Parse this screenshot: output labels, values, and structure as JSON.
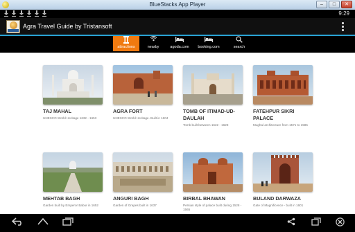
{
  "window": {
    "title": "BlueStacks App Player"
  },
  "status_bar": {
    "time": "9:29",
    "notification_icons": [
      "download-icon",
      "download-icon",
      "download-icon",
      "download-icon",
      "download-icon",
      "download-icon"
    ]
  },
  "action_bar": {
    "app_title": "Agra Travel Guide by Tristansoft",
    "app_icon": "agra-app-icon"
  },
  "tabs": [
    {
      "label": "attractions",
      "icon": "pillar-icon",
      "active": true
    },
    {
      "label": "nearby",
      "icon": "signal-icon",
      "active": false
    },
    {
      "label": "agoda.com",
      "icon": "bed-icon",
      "active": false
    },
    {
      "label": "booking.com",
      "icon": "bed-icon",
      "active": false
    },
    {
      "label": "search",
      "icon": "search-icon",
      "active": false
    }
  ],
  "attractions": [
    {
      "name": "TAJ MAHAL",
      "description": "UNESCO World Heritage 1632 - 1653"
    },
    {
      "name": "AGRA FORT",
      "description": "UNESCO World Heritage. Built in 1604"
    },
    {
      "name": "TOMB OF ITIMAD-UD-DAULAH",
      "description": "Tomb built between 1622 - 1628"
    },
    {
      "name": "FATEHPUR SIKRI PALACE",
      "description": "Mughal architecture from 1571 to 1585"
    },
    {
      "name": "MEHTAB BAGH",
      "description": "Garden built by Emperor Babur in 1652"
    },
    {
      "name": "ANGURI BAGH",
      "description": "Garden of Grapes built in 1637"
    },
    {
      "name": "BIRBAL BHAWAN",
      "description": "Persian style of palace built during 1528 - 1565"
    },
    {
      "name": "BULAND DARWAZA",
      "description": "Gate of Magnificence - built in 1601"
    }
  ],
  "nav_bar": {
    "icons": [
      "back-icon",
      "home-icon",
      "recent-apps-icon",
      "share-icon",
      "window-icon",
      "close-icon"
    ]
  },
  "colors": {
    "accent": "#f07a10",
    "action_bar_underline": "#2aa3d4",
    "background": "#ffffff"
  }
}
